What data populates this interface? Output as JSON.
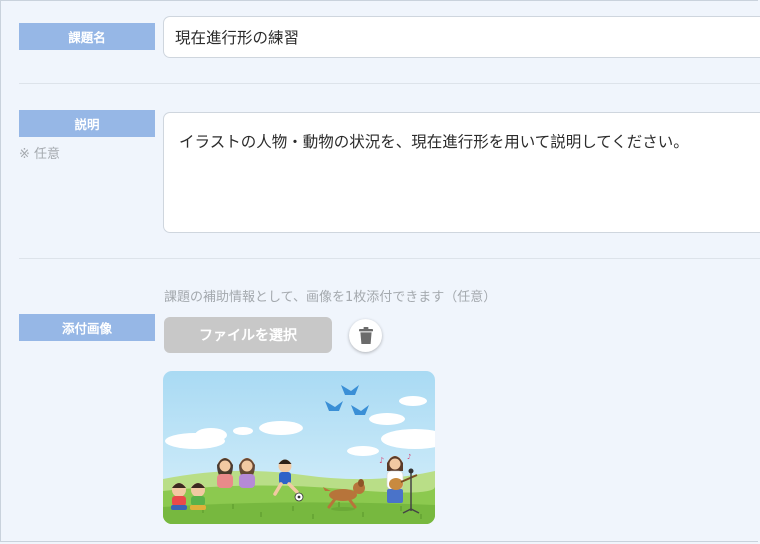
{
  "form": {
    "title": {
      "label": "課題名",
      "value": "現在進行形の練習"
    },
    "description": {
      "label": "説明",
      "optional_note": "※ 任意",
      "value": "イラストの人物・動物の状況を、現在進行形を用いて説明してください。"
    },
    "attachment": {
      "label": "添付画像",
      "hint": "課題の補助情報として、画像を1枚添付できます（任意）",
      "select_button_label": "ファイルを選択",
      "delete_icon": "trash-icon",
      "preview_image": "park-illustration"
    }
  },
  "colors": {
    "label_bg": "#96b7e6",
    "page_bg": "#f0f5fc",
    "button_bg": "#c8c8c8",
    "muted_text": "#a4a9ae"
  }
}
